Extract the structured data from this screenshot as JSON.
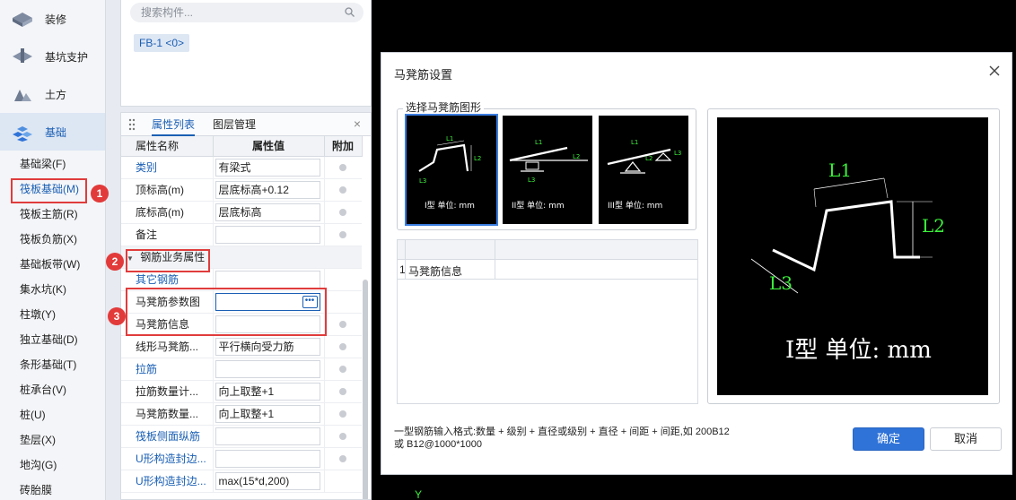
{
  "sidebar": {
    "categories": [
      {
        "label": "装修",
        "icon": "decoration-icon"
      },
      {
        "label": "基坑支护",
        "icon": "pit-support-icon"
      },
      {
        "label": "土方",
        "icon": "earthwork-icon"
      },
      {
        "label": "基础",
        "icon": "foundation-icon"
      }
    ],
    "items": [
      "基础梁(F)",
      "筏板基础(M)",
      "筏板主筋(R)",
      "筏板负筋(X)",
      "基础板带(W)",
      "集水坑(K)",
      "柱墩(Y)",
      "独立基础(D)",
      "条形基础(T)",
      "桩承台(V)",
      "桩(U)",
      "垫层(X)",
      "地沟(G)",
      "砖胎膜"
    ]
  },
  "component_panel": {
    "search_placeholder": "搜索构件...",
    "chip": "FB-1 <0>"
  },
  "props_panel": {
    "tab_active": "属性列表",
    "tab_other": "图层管理",
    "col_name": "属性名称",
    "col_value": "属性值",
    "col_add": "附加",
    "rows": [
      {
        "name": "类别",
        "value": "有梁式",
        "link": true
      },
      {
        "name": "顶标高(m)",
        "value": "层底标高+0.12",
        "link": false
      },
      {
        "name": "底标高(m)",
        "value": "层底标高",
        "link": false
      },
      {
        "name": "备注",
        "value": "",
        "link": false
      }
    ],
    "group_label": "钢筋业务属性",
    "group_rows": [
      {
        "name": "其它钢筋",
        "value": "",
        "link": true
      },
      {
        "name": "马凳筋参数图",
        "value": "",
        "link": false
      },
      {
        "name": "马凳筋信息",
        "value": "",
        "link": false
      },
      {
        "name": "线形马凳筋...",
        "value": "平行横向受力筋",
        "link": false
      },
      {
        "name": "拉筋",
        "value": "",
        "link": true
      },
      {
        "name": "拉筋数量计...",
        "value": "向上取整+1",
        "link": false
      },
      {
        "name": "马凳筋数量...",
        "value": "向上取整+1",
        "link": false
      },
      {
        "name": "筏板侧面纵筋",
        "value": "",
        "link": true
      },
      {
        "name": "U形构造封边...",
        "value": "",
        "link": true
      },
      {
        "name": "U形构造封边...",
        "value": "max(15*d,200)",
        "link": true
      }
    ]
  },
  "annotations": [
    "1",
    "2",
    "3"
  ],
  "dialog": {
    "title": "马凳筋设置",
    "group_label": "选择马凳筋图形",
    "thumbs": [
      {
        "caption": "I型 单位: mm",
        "labels": [
          "L1",
          "L2",
          "L3"
        ]
      },
      {
        "caption": "II型 单位: mm",
        "labels": [
          "L1",
          "L2",
          "L3"
        ]
      },
      {
        "caption": "III型 单位: mm",
        "labels": [
          "L1",
          "L2",
          "L3"
        ]
      }
    ],
    "table_row_index": "1",
    "table_row_label": "马凳筋信息",
    "preview": {
      "l1": "L1",
      "l2": "L2",
      "l3": "L3",
      "caption": "I型 单位: mm"
    },
    "hint_line1": "一型钢筋输入格式:数量 + 级别 + 直径或级别 + 直径 + 间距 + 间距,如 200B12",
    "hint_line2": "或 B12@1000*1000",
    "ok": "确定",
    "cancel": "取消"
  },
  "canvas_axis_label": "Y",
  "colors": {
    "accent": "#1a5fb4",
    "annotation": "#e03c3c",
    "drawing_line": "#ffffff",
    "drawing_label": "#3cf03c"
  }
}
